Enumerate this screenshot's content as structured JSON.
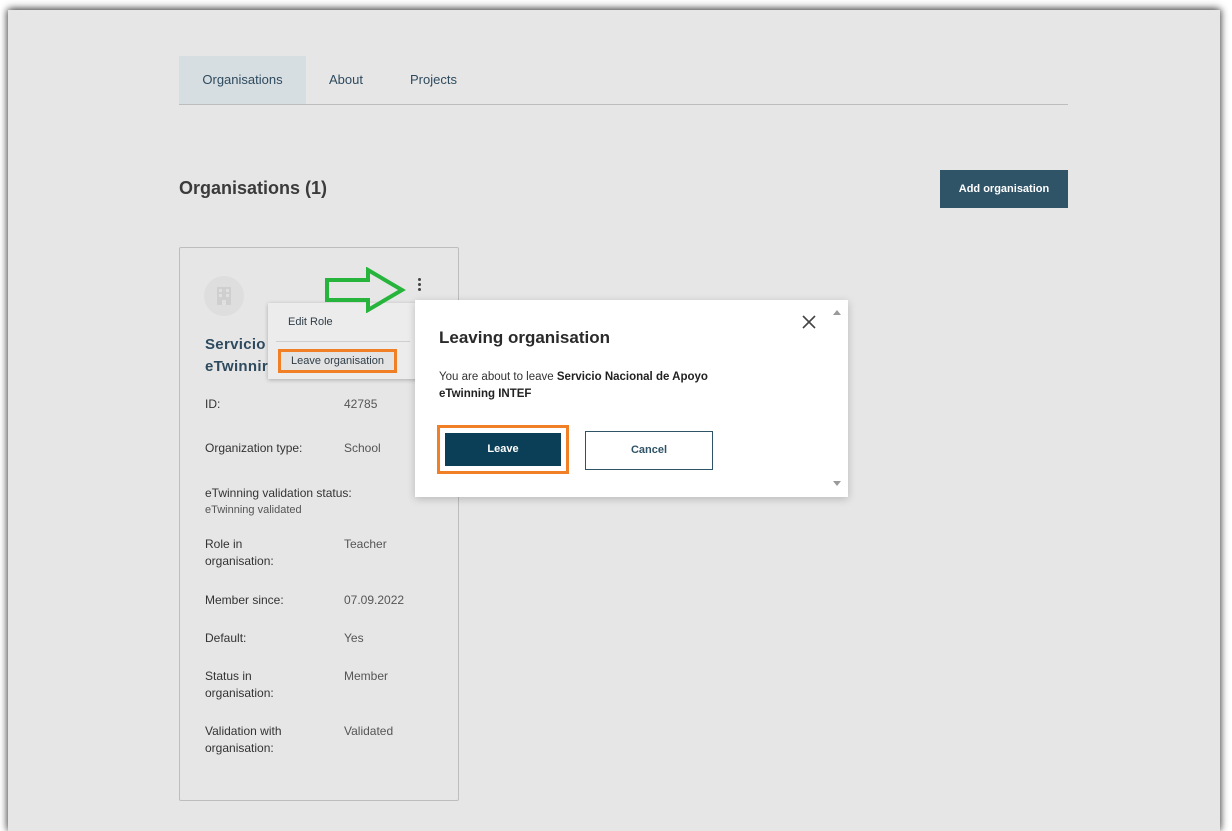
{
  "tabs": [
    {
      "label": "Organisations",
      "active": true
    },
    {
      "label": "About",
      "active": false
    },
    {
      "label": "Projects",
      "active": false
    }
  ],
  "section": {
    "title": "Organisations (1)",
    "add_button_label": "Add organisation"
  },
  "card": {
    "name_line1": "Servicio",
    "name_line2": "eTwinnir",
    "fields": {
      "id_label": "ID:",
      "id_value": "42785",
      "org_type_label": "Organization type:",
      "org_type_value": "School",
      "validation_status_label": "eTwinning validation status:",
      "validation_status_value": "eTwinning validated",
      "role_label_1": "Role in",
      "role_label_2": "organisation:",
      "role_value": "Teacher",
      "member_since_label": "Member since:",
      "member_since_value": "07.09.2022",
      "default_label": "Default:",
      "default_value": "Yes",
      "status_label_1": "Status in",
      "status_label_2": "organisation:",
      "status_value": "Member",
      "validation_label_1": "Validation with",
      "validation_label_2": "organisation:",
      "validation_value": "Validated"
    }
  },
  "dropdown": {
    "edit_role": "Edit Role",
    "leave_organisation": "Leave organisation"
  },
  "modal": {
    "title": "Leaving organisation",
    "text_prefix": "You are about to leave ",
    "org_name_line1": "Servicio Nacional de Apoyo",
    "org_name_line2": "eTwinning INTEF",
    "leave_label": "Leave",
    "cancel_label": "Cancel"
  },
  "colors": {
    "primary": "#2f5367",
    "leave_button": "#0b3f57",
    "highlight_orange": "#f07f25",
    "annotation_arrow": "#27b43c",
    "background": "#e6e6e6"
  },
  "icons": {
    "org_icon": "building-icon",
    "menu_icon": "kebab-menu-icon",
    "close_icon": "close-icon",
    "annotation": "arrow-right-icon"
  }
}
